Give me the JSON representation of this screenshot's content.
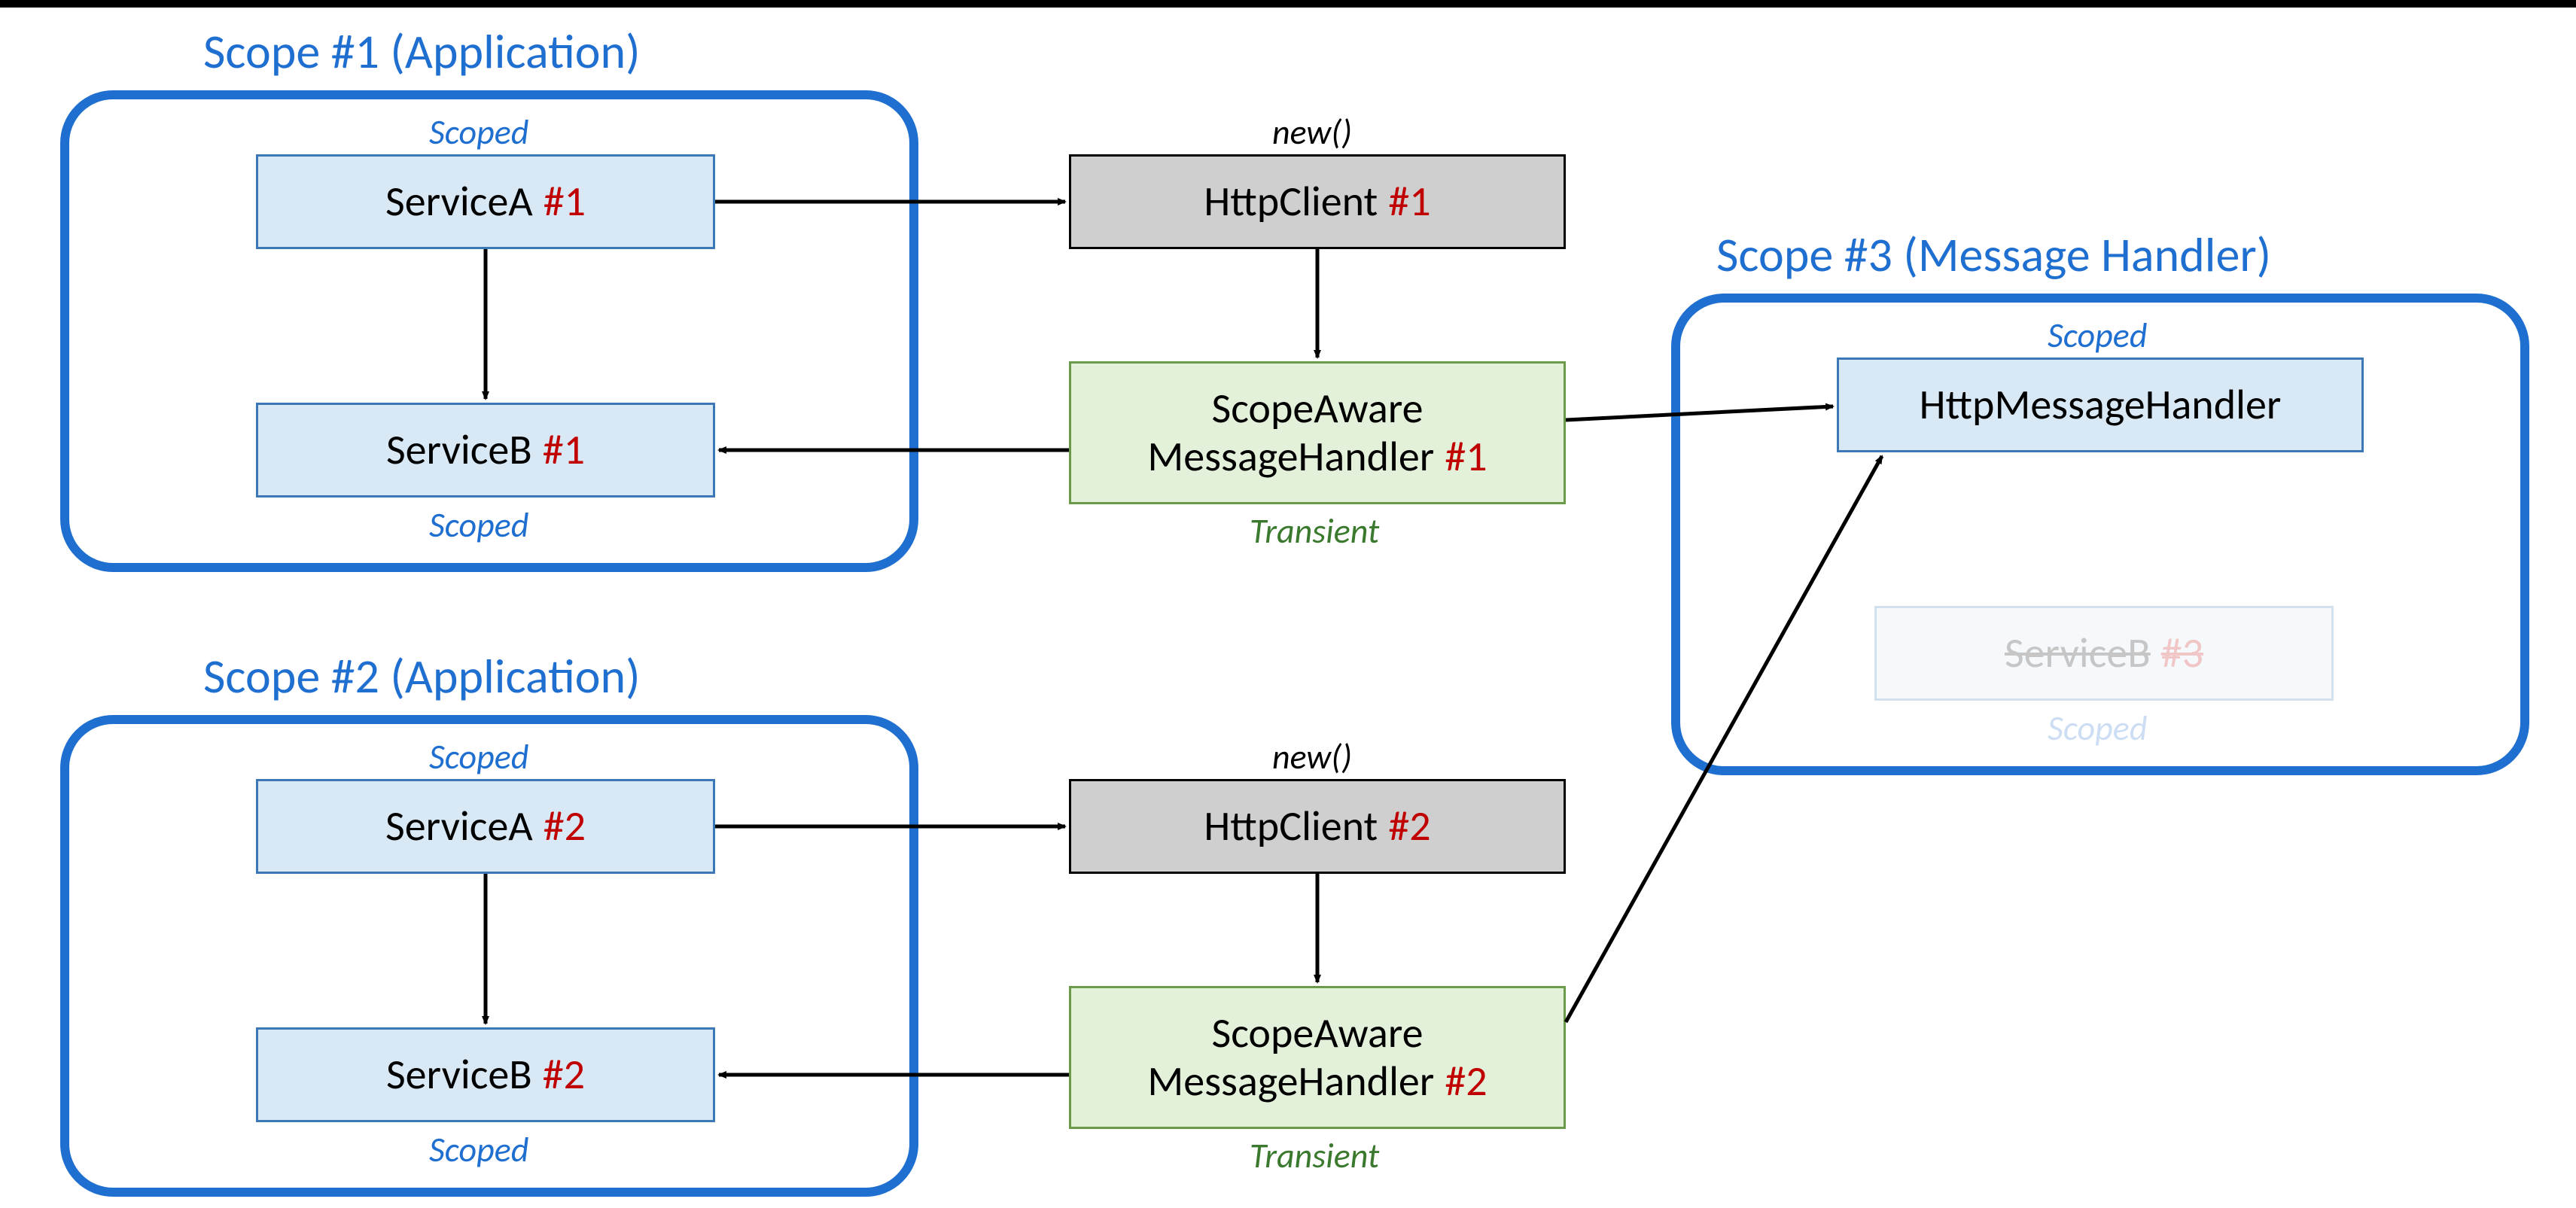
{
  "scopes": {
    "s1": {
      "title": "Scope #1 (Application)"
    },
    "s2": {
      "title": "Scope #2 (Application)"
    },
    "s3": {
      "title": "Scope #3 (Message Handler)"
    }
  },
  "boxes": {
    "serviceA1": {
      "name": "ServiceA",
      "idx": "#1"
    },
    "serviceB1": {
      "name": "ServiceB",
      "idx": "#1"
    },
    "serviceA2": {
      "name": "ServiceA",
      "idx": "#2"
    },
    "serviceB2": {
      "name": "ServiceB",
      "idx": "#2"
    },
    "httpClient1": {
      "name": "HttpClient",
      "idx": "#1"
    },
    "httpClient2": {
      "name": "HttpClient",
      "idx": "#2"
    },
    "scopeAware1": {
      "line1": "ScopeAware",
      "line2name": "MessageHandler",
      "line2idx": "#1"
    },
    "scopeAware2": {
      "line1": "ScopeAware",
      "line2name": "MessageHandler",
      "line2idx": "#2"
    },
    "httpMsgHandler": {
      "name": "HttpMessageHandler"
    },
    "serviceB3": {
      "name": "ServiceB",
      "idx": "#3"
    }
  },
  "anno": {
    "scoped": "Scoped",
    "transient": "Transient",
    "newFn": "new()"
  },
  "colors": {
    "scopeBorder": "#1f6fd1",
    "blueFill": "#d9e8f5",
    "blueBorder": "#3b78b5",
    "grayFill": "#cfcfcf",
    "greenFill": "#e3f1da",
    "greenBorder": "#6a9a4a",
    "red": "#c00000"
  }
}
